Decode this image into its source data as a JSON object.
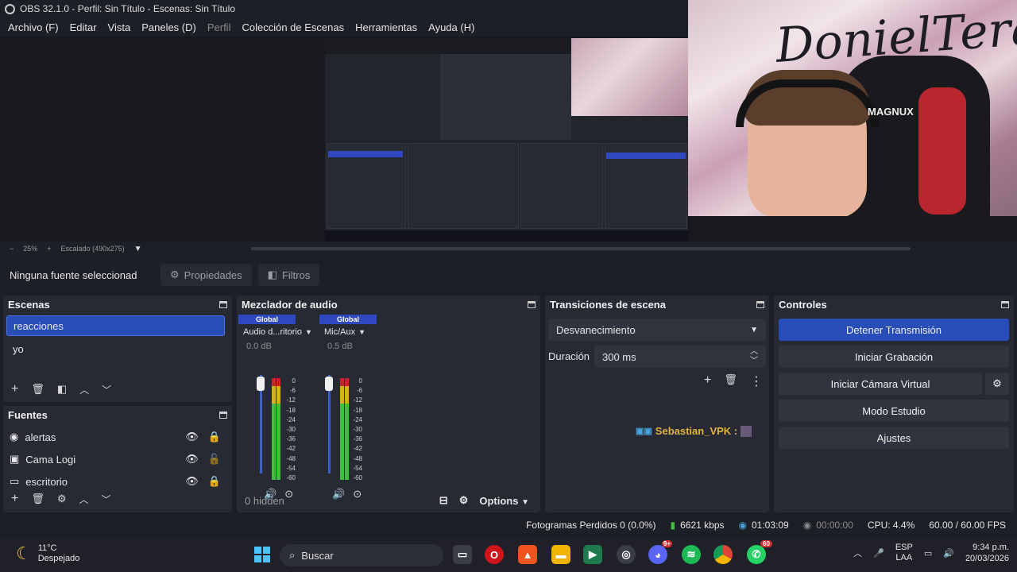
{
  "window": {
    "title": "OBS 32.1.0 - Perfil: Sin Título - Escenas: Sin Título"
  },
  "menu": [
    "Archivo (F)",
    "Editar",
    "Vista",
    "Paneles (D)",
    "Perfil",
    "Colección de Escenas",
    "Herramientas",
    "Ayuda (H)"
  ],
  "webcam": {
    "graffiti": "DonielTeran",
    "headset_brand": "MAGNUX"
  },
  "zoombar": {
    "minus": "−",
    "zoom": "25%",
    "plus": "+",
    "scale": "Escalado (490x275)"
  },
  "context": {
    "none_selected": "Ninguna fuente seleccionad",
    "properties": "Propiedades",
    "filters": "Filtros"
  },
  "scenes": {
    "title": "Escenas",
    "items": [
      "reacciones",
      "yo"
    ],
    "active_index": 0
  },
  "sources": {
    "title": "Fuentes",
    "items": [
      {
        "name": "alertas",
        "icon": "globe-icon",
        "locked": true
      },
      {
        "name": "Cama Logi",
        "icon": "camera-icon",
        "locked": false
      },
      {
        "name": "escritorio",
        "icon": "monitor-icon",
        "locked": true
      }
    ]
  },
  "mixer": {
    "title": "Mezclador de audio",
    "channels": [
      {
        "global": "Global",
        "name": "Audio d...ritorio",
        "db": "0.0 dB",
        "level": 1.0
      },
      {
        "global": "Global",
        "name": "Mic/Aux",
        "db": "0.5 dB",
        "level": 1.0
      }
    ],
    "scale": [
      "0",
      "-6",
      "-12",
      "-18",
      "-24",
      "-30",
      "-36",
      "-42",
      "-48",
      "-54",
      "-60"
    ],
    "hidden": "0 hidden",
    "options": "Options"
  },
  "transitions": {
    "title": "Transiciones de escena",
    "selected": "Desvanecimiento",
    "duration_label": "Duración",
    "duration_value": "300 ms"
  },
  "chat": {
    "user": "Sebastian_VPK :"
  },
  "controls": {
    "title": "Controles",
    "buttons": [
      "Detener Transmisión",
      "Iniciar Grabación",
      "Iniciar Cámara Virtual",
      "Modo Estudio",
      "Ajustes"
    ]
  },
  "status": {
    "dropped": "Fotogramas Perdidos 0 (0.0%)",
    "bitrate": "6621 kbps",
    "stream_time": "01:03:09",
    "rec_time": "00:00:00",
    "cpu": "CPU: 4.4%",
    "fps": "60.00 / 60.00 FPS"
  },
  "taskbar": {
    "temp": "11°C",
    "weather": "Despejado",
    "search": "Buscar",
    "whatsapp_badge": "60",
    "discord_badge": "9+",
    "lang_top": "ESP",
    "lang_bottom": "LAA",
    "time": "9:34 p.m.",
    "date": "20/03/2026"
  },
  "colors": {
    "accent": "#284cb8",
    "panel": "#272a33",
    "background": "#1d1f26",
    "chat_name": "#e0b33a"
  }
}
